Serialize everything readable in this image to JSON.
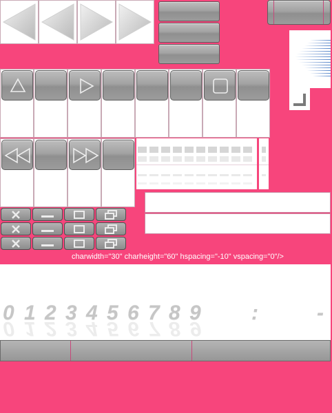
{
  "skin_note": "charwidth=\"30\" charheight=\"60\" hspacing=\"-10\" vspacing=\"0\"/>",
  "digits": [
    "0",
    "1",
    "2",
    "3",
    "4",
    "5",
    "6",
    "7",
    "8",
    "9"
  ],
  "digit_colon": ":",
  "digit_dash": "-",
  "icons": {
    "nav_arrows": [
      "arrow-left-icon",
      "arrow-left-icon",
      "arrow-right-icon",
      "arrow-right-icon"
    ],
    "row_a": [
      "eject-icon",
      "blank",
      "play-icon",
      "blank",
      "blank",
      "blank",
      "stop-icon",
      "blank"
    ],
    "row_b": [
      "rewind-icon",
      "blank",
      "fast-forward-icon",
      "blank"
    ],
    "window_buttons": [
      "close-icon",
      "minimize-icon",
      "maximize-icon",
      "restore-icon"
    ]
  },
  "colors": {
    "background": "#f7457c",
    "button_grey": "#9a9a9a",
    "icon_line": "#ededed"
  }
}
